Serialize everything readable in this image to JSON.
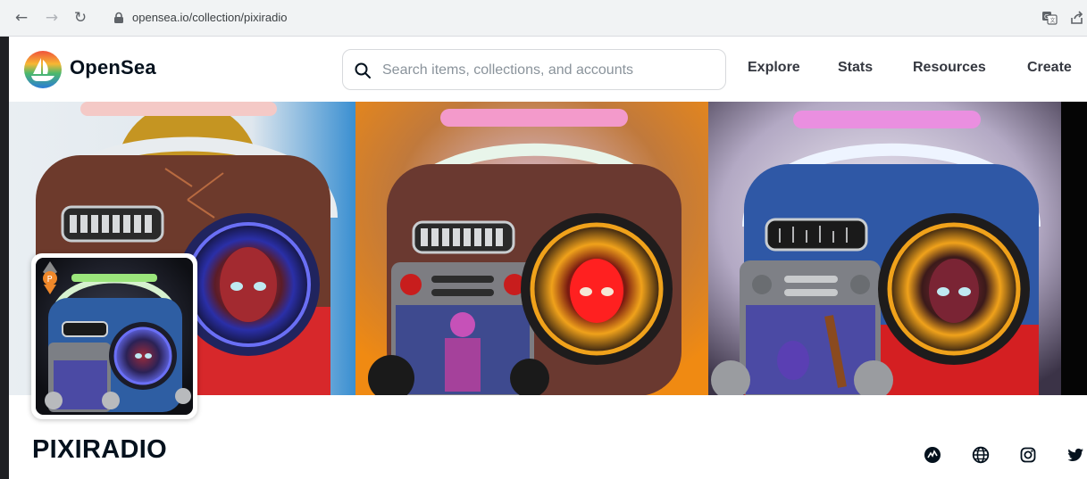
{
  "browser": {
    "url": "opensea.io/collection/pixiradio"
  },
  "header": {
    "brand": "OpenSea",
    "search_placeholder": "Search items, collections, and accounts",
    "nav": [
      "Explore",
      "Stats",
      "Resources",
      "Create"
    ]
  },
  "collection": {
    "name": "PIXIRADIO",
    "social_icons": [
      "opensea-stats-icon",
      "globe-icon",
      "instagram-icon",
      "twitter-icon"
    ]
  },
  "colors": {
    "brand_blue": "#2081e2",
    "text_dark": "#04111d"
  }
}
